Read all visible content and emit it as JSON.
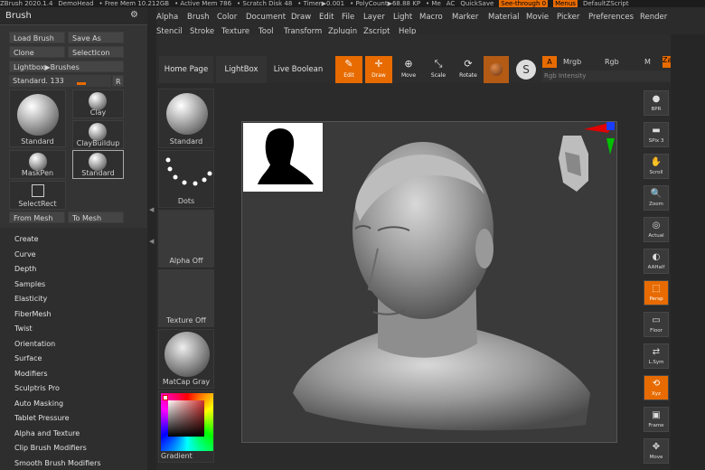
{
  "titlebar": {
    "items": [
      "ZBrush 2020.1.4",
      "DemoHead",
      "• Free Mem 10.212GB",
      "• Active Mem 786",
      "• Scratch Disk 48",
      "• Timer▶0.001",
      "• PolyCount▶68.88 KP",
      "• Me",
      "AC",
      "QuickSave",
      "See-through 0",
      "Menus",
      "DefaultZScript"
    ]
  },
  "brush_palette": {
    "title": "Brush",
    "load_brush": "Load Brush",
    "save_as": "Save As",
    "clone": "Clone",
    "select_icon": "SelectIcon",
    "lightbox_brushes": "Lightbox▶Brushes",
    "standard_slider": "Standard. 133",
    "r_button": "R",
    "brushes": [
      "Standard",
      "Clay",
      "ClayBuildup",
      "MaskPen",
      "Standard",
      "SelectRect"
    ],
    "from_mesh": "From Mesh",
    "to_mesh": "To Mesh"
  },
  "submenu": [
    "Create",
    "Curve",
    "Depth",
    "Samples",
    "Elasticity",
    "FiberMesh",
    "Twist",
    "Orientation",
    "Surface",
    "Modifiers",
    "Sculptris Pro",
    "Auto Masking",
    "Tablet Pressure",
    "Alpha and Texture",
    "Clip Brush Modifiers",
    "Smooth Brush Modifiers"
  ],
  "menubar": {
    "row1": [
      "Alpha",
      "Brush",
      "Color",
      "Document",
      "Draw",
      "Edit",
      "File",
      "Layer",
      "Light",
      "Macro",
      "Marker",
      "Material",
      "Movie",
      "Picker",
      "Preferences",
      "Render"
    ],
    "row2": [
      "Stencil",
      "Stroke",
      "Texture",
      "Tool",
      "Transform",
      "Zplugin",
      "Zscript",
      "Help"
    ]
  },
  "toolbar": {
    "tabs": [
      "Home Page",
      "LightBox",
      "Live Boolean"
    ],
    "tools": [
      {
        "label": "Edit",
        "icon": "edit-icon",
        "active": true
      },
      {
        "label": "Draw",
        "icon": "draw-icon",
        "active": true
      },
      {
        "label": "Move",
        "icon": "move-icon",
        "active": false
      },
      {
        "label": "Scale",
        "icon": "scale-icon",
        "active": false
      },
      {
        "label": "Rotate",
        "icon": "rotate-icon",
        "active": false
      }
    ],
    "a_button": "A",
    "mrgb": "Mrgb",
    "rgb": "Rgb",
    "m": "M",
    "zadd": "Za",
    "rgb_intensity": "Rgb Intensity"
  },
  "shelf": {
    "items": [
      "Standard",
      "Dots",
      "Alpha Off",
      "Texture Off",
      "MatCap Gray",
      "Gradient"
    ]
  },
  "right_column": [
    {
      "label": "BPR",
      "icon": "bpr-icon",
      "active": false
    },
    {
      "label": "SPix 3",
      "icon": "spix-icon",
      "active": false
    },
    {
      "label": "Scroll",
      "icon": "scroll-icon",
      "active": false
    },
    {
      "label": "Zoom",
      "icon": "zoom-icon",
      "active": false
    },
    {
      "label": "Actual",
      "icon": "actual-icon",
      "active": false
    },
    {
      "label": "AAHalf",
      "icon": "aahalf-icon",
      "active": false
    },
    {
      "label": "Persp",
      "icon": "persp-icon",
      "active": true
    },
    {
      "label": "Floor",
      "icon": "floor-icon",
      "active": false
    },
    {
      "label": "L.Sym",
      "icon": "lsym-icon",
      "active": false
    },
    {
      "label": "Xyz",
      "icon": "xyz-icon",
      "active": true
    },
    {
      "label": "Frame",
      "icon": "frame-icon",
      "active": false
    },
    {
      "label": "Move",
      "icon": "move-icon",
      "active": false
    }
  ],
  "colors": {
    "accent": "#e76b00",
    "panel": "#343434",
    "background": "#2b2b2b"
  }
}
